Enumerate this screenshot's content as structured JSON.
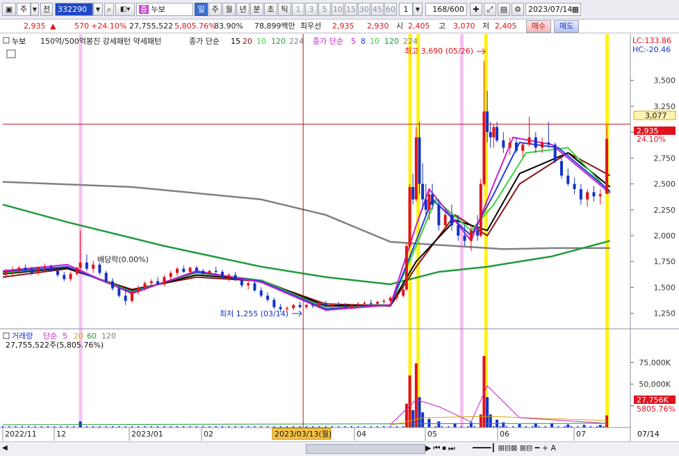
{
  "toolbar": {
    "market_select": "주",
    "prev_label": "전",
    "code": "332290",
    "group_icon": "중",
    "name": "누보",
    "periods": [
      "일",
      "주",
      "월",
      "년",
      "분",
      "초",
      "틱"
    ],
    "active_period": "일",
    "interval_buttons": [
      "1",
      "3",
      "5",
      "10",
      "15",
      "30",
      "45",
      "60"
    ],
    "interval_value": "1",
    "count": "168",
    "count_total": "/600",
    "date": "2023/07/14"
  },
  "quote": {
    "price": "2,935",
    "arrow": "▲",
    "change": "570",
    "change_pct": "+24.10%",
    "volume": "27,755,522",
    "volume_pct": "5,805.76%",
    "ratio": "83.90%",
    "amount": "78,899백만",
    "best_label": "최우선",
    "ask": "2,935",
    "bid": "2,930",
    "open_label": "시",
    "open": "2,405",
    "high_label": "고",
    "high": "3,070",
    "low_label": "저",
    "low": "2,405",
    "buy_button": "매수",
    "sell_button": "매도"
  },
  "legend": {
    "name": "누보",
    "pattern": "150억/500억봉진 강세패턴 약세패턴",
    "ma_price_label": "종가 단순",
    "ma_price_periods": [
      "15",
      "20",
      "10",
      "120",
      "224"
    ],
    "ma_price2_label": "종가 단순",
    "ma_price2_periods": [
      "5",
      "8",
      "10",
      "120",
      "224"
    ],
    "lc": "LC:133.86",
    "hc": "HC:-20.46"
  },
  "annotations": {
    "high": "최고 3,690 (05/26)",
    "low": "최저 1,255 (03/14)",
    "dividend": "배당락(0.00%)"
  },
  "price_labels": {
    "crosshair": "3,077",
    "current": "2,935",
    "current_pct": "24.10%"
  },
  "volume_panel": {
    "title": "거래량",
    "ma_label": "단순",
    "ma_periods": [
      "5",
      "20",
      "60",
      "120"
    ],
    "value": "27,755,522주(5,805.76%)",
    "current": "27,756K",
    "current_pct": "5805.76%"
  },
  "x_axis": {
    "ticks": [
      {
        "label": "2022/11",
        "x": 0
      },
      {
        "label": "12",
        "x": 22
      },
      {
        "label": "2023/01",
        "x": 44
      },
      {
        "label": "02",
        "x": 66
      },
      {
        "label": "04",
        "x": 110
      },
      {
        "label": "05",
        "x": 132
      },
      {
        "label": "06",
        "x": 154
      },
      {
        "label": "07",
        "x": 176
      }
    ],
    "cursor_date": "2023/03/13(월)",
    "right_date": "07/14"
  },
  "colors": {
    "up": "#e0131c",
    "down": "#1431c9",
    "ma5": "#c81fc8",
    "ma8": "#1f3fe0",
    "ma10": "#3ad33a",
    "ma15": "#000000",
    "ma20": "#8a1212",
    "ma120": "#1f9a3a",
    "ma224": "#808080",
    "highlight_yellow": "#fff100",
    "highlight_pink": "#f2b3ee"
  },
  "chart_data": {
    "type": "candlestick",
    "title": "누보",
    "x_range": [
      0,
      190
    ],
    "y_range": [
      1100,
      3800
    ],
    "y_ticks": [
      1250,
      1500,
      1750,
      2000,
      2250,
      2500,
      2750,
      3000,
      3250,
      3500
    ],
    "y_tick_labels": [
      "1,250",
      "1,500",
      "1,750",
      "2,000",
      "2,250",
      "2,500",
      "2,750",
      "3,000",
      "3,250",
      "3,500"
    ],
    "volume_ticks": [
      25000,
      50000,
      75000
    ],
    "volume_tick_labels": [
      "",
      "50,000K",
      "75,000K"
    ],
    "crosshair_x": 93,
    "crosshair_price": 3077,
    "current_price": 2935,
    "highlight_days": [
      {
        "x": 24,
        "color": "pink"
      },
      {
        "x": 126,
        "color": "yellow"
      },
      {
        "x": 128.5,
        "color": "yellow"
      },
      {
        "x": 142,
        "color": "pink"
      },
      {
        "x": 149.5,
        "color": "yellow"
      },
      {
        "x": 187,
        "color": "yellow"
      }
    ],
    "moving_averages": [
      {
        "name": "224",
        "color_key": "ma224",
        "points": [
          [
            0,
            2520
          ],
          [
            40,
            2470
          ],
          [
            80,
            2350
          ],
          [
            100,
            2200
          ],
          [
            120,
            1940
          ],
          [
            140,
            1900
          ],
          [
            155,
            1870
          ],
          [
            170,
            1880
          ],
          [
            188,
            1880
          ]
        ]
      },
      {
        "name": "120",
        "color_key": "ma120",
        "points": [
          [
            0,
            2300
          ],
          [
            20,
            2130
          ],
          [
            50,
            1900
          ],
          [
            80,
            1700
          ],
          [
            100,
            1600
          ],
          [
            120,
            1530
          ],
          [
            135,
            1650
          ],
          [
            150,
            1700
          ],
          [
            170,
            1800
          ],
          [
            188,
            1950
          ]
        ]
      },
      {
        "name": "20",
        "color_key": "ma20",
        "points": [
          [
            0,
            1600
          ],
          [
            20,
            1680
          ],
          [
            40,
            1480
          ],
          [
            60,
            1600
          ],
          [
            80,
            1560
          ],
          [
            100,
            1340
          ],
          [
            120,
            1320
          ],
          [
            128,
            1700
          ],
          [
            140,
            2200
          ],
          [
            150,
            2000
          ],
          [
            160,
            2500
          ],
          [
            175,
            2800
          ],
          [
            188,
            2580
          ]
        ]
      },
      {
        "name": "15",
        "color_key": "ma15",
        "points": [
          [
            0,
            1630
          ],
          [
            20,
            1690
          ],
          [
            40,
            1470
          ],
          [
            60,
            1620
          ],
          [
            80,
            1570
          ],
          [
            100,
            1320
          ],
          [
            120,
            1330
          ],
          [
            128,
            1750
          ],
          [
            140,
            2150
          ],
          [
            150,
            2050
          ],
          [
            160,
            2600
          ],
          [
            175,
            2800
          ],
          [
            188,
            2470
          ]
        ]
      },
      {
        "name": "10",
        "color_key": "ma10",
        "points": [
          [
            0,
            1640
          ],
          [
            20,
            1700
          ],
          [
            40,
            1460
          ],
          [
            60,
            1640
          ],
          [
            80,
            1570
          ],
          [
            100,
            1300
          ],
          [
            120,
            1330
          ],
          [
            128,
            1900
          ],
          [
            134,
            2350
          ],
          [
            145,
            2050
          ],
          [
            152,
            2300
          ],
          [
            162,
            2800
          ],
          [
            175,
            2850
          ],
          [
            188,
            2420
          ]
        ]
      },
      {
        "name": "8",
        "color_key": "ma8",
        "points": [
          [
            0,
            1650
          ],
          [
            20,
            1700
          ],
          [
            40,
            1450
          ],
          [
            60,
            1650
          ],
          [
            80,
            1560
          ],
          [
            100,
            1290
          ],
          [
            120,
            1330
          ],
          [
            128,
            1950
          ],
          [
            133,
            2350
          ],
          [
            145,
            2000
          ],
          [
            152,
            2400
          ],
          [
            160,
            2900
          ],
          [
            172,
            2850
          ],
          [
            188,
            2430
          ]
        ]
      },
      {
        "name": "5",
        "color_key": "ma5",
        "points": [
          [
            0,
            1660
          ],
          [
            20,
            1720
          ],
          [
            40,
            1440
          ],
          [
            60,
            1660
          ],
          [
            80,
            1550
          ],
          [
            100,
            1280
          ],
          [
            120,
            1330
          ],
          [
            128,
            2100
          ],
          [
            132,
            2450
          ],
          [
            145,
            1950
          ],
          [
            152,
            2500
          ],
          [
            158,
            2950
          ],
          [
            170,
            2880
          ],
          [
            188,
            2410
          ]
        ]
      }
    ],
    "candles": [
      [
        1,
        1620,
        1680,
        1590,
        1650
      ],
      [
        3,
        1650,
        1700,
        1610,
        1660
      ],
      [
        5,
        1660,
        1710,
        1630,
        1690
      ],
      [
        7,
        1690,
        1720,
        1640,
        1670
      ],
      [
        9,
        1670,
        1700,
        1620,
        1640
      ],
      [
        11,
        1640,
        1700,
        1620,
        1690
      ],
      [
        13,
        1690,
        1730,
        1660,
        1700
      ],
      [
        15,
        1700,
        1720,
        1650,
        1660
      ],
      [
        17,
        1660,
        1690,
        1600,
        1620
      ],
      [
        19,
        1620,
        1650,
        1560,
        1580
      ],
      [
        21,
        1580,
        1650,
        1560,
        1630
      ],
      [
        23,
        1630,
        1700,
        1610,
        1690
      ],
      [
        24,
        1690,
        2050,
        1670,
        1740
      ],
      [
        26,
        1740,
        1820,
        1660,
        1680
      ],
      [
        28,
        1680,
        1760,
        1640,
        1720
      ],
      [
        30,
        1720,
        1740,
        1620,
        1640
      ],
      [
        32,
        1640,
        1660,
        1540,
        1560
      ],
      [
        34,
        1560,
        1590,
        1470,
        1490
      ],
      [
        36,
        1490,
        1520,
        1400,
        1420
      ],
      [
        38,
        1420,
        1480,
        1330,
        1370
      ],
      [
        40,
        1370,
        1470,
        1350,
        1460
      ],
      [
        42,
        1460,
        1520,
        1430,
        1500
      ],
      [
        44,
        1500,
        1560,
        1470,
        1540
      ],
      [
        46,
        1540,
        1580,
        1500,
        1560
      ],
      [
        48,
        1560,
        1600,
        1520,
        1530
      ],
      [
        50,
        1530,
        1620,
        1510,
        1600
      ],
      [
        52,
        1600,
        1660,
        1570,
        1640
      ],
      [
        54,
        1640,
        1700,
        1610,
        1680
      ],
      [
        56,
        1680,
        1710,
        1640,
        1650
      ],
      [
        58,
        1650,
        1700,
        1620,
        1690
      ],
      [
        60,
        1690,
        1710,
        1640,
        1660
      ],
      [
        62,
        1660,
        1680,
        1610,
        1630
      ],
      [
        64,
        1630,
        1670,
        1600,
        1660
      ],
      [
        66,
        1660,
        1700,
        1630,
        1650
      ],
      [
        68,
        1650,
        1670,
        1580,
        1600
      ],
      [
        70,
        1600,
        1640,
        1560,
        1620
      ],
      [
        72,
        1620,
        1650,
        1560,
        1570
      ],
      [
        74,
        1570,
        1590,
        1500,
        1520
      ],
      [
        76,
        1520,
        1560,
        1480,
        1540
      ],
      [
        78,
        1540,
        1560,
        1460,
        1470
      ],
      [
        80,
        1470,
        1500,
        1400,
        1420
      ],
      [
        82,
        1420,
        1450,
        1360,
        1380
      ],
      [
        84,
        1380,
        1400,
        1290,
        1310
      ],
      [
        86,
        1310,
        1340,
        1260,
        1290
      ],
      [
        88,
        1290,
        1320,
        1255,
        1300
      ],
      [
        90,
        1300,
        1340,
        1280,
        1330
      ],
      [
        92,
        1330,
        1360,
        1300,
        1310
      ],
      [
        94,
        1310,
        1340,
        1290,
        1330
      ],
      [
        96,
        1330,
        1350,
        1300,
        1320
      ],
      [
        98,
        1320,
        1370,
        1300,
        1350
      ],
      [
        100,
        1350,
        1370,
        1310,
        1320
      ],
      [
        102,
        1320,
        1350,
        1300,
        1340
      ],
      [
        104,
        1340,
        1360,
        1310,
        1330
      ],
      [
        106,
        1330,
        1350,
        1300,
        1310
      ],
      [
        108,
        1310,
        1340,
        1290,
        1330
      ],
      [
        110,
        1330,
        1360,
        1310,
        1340
      ],
      [
        112,
        1340,
        1370,
        1320,
        1350
      ],
      [
        114,
        1350,
        1380,
        1330,
        1340
      ],
      [
        116,
        1340,
        1370,
        1320,
        1360
      ],
      [
        118,
        1360,
        1390,
        1340,
        1370
      ],
      [
        120,
        1370,
        1420,
        1350,
        1400
      ],
      [
        122,
        1400,
        1450,
        1370,
        1420
      ],
      [
        124,
        1420,
        1500,
        1400,
        1480
      ],
      [
        125,
        1480,
        1930,
        1470,
        1900
      ],
      [
        126,
        1900,
        2500,
        1880,
        2470
      ],
      [
        127,
        2470,
        2600,
        2300,
        2350
      ],
      [
        128,
        2350,
        3050,
        2330,
        2950
      ],
      [
        129,
        2950,
        3100,
        2400,
        2500
      ],
      [
        130,
        2500,
        2700,
        2250,
        2350
      ],
      [
        131,
        2350,
        2500,
        2200,
        2250
      ],
      [
        132,
        2250,
        2450,
        2150,
        2400
      ],
      [
        133,
        2400,
        2500,
        2250,
        2300
      ],
      [
        135,
        2300,
        2350,
        2050,
        2100
      ],
      [
        137,
        2100,
        2250,
        2050,
        2200
      ],
      [
        139,
        2200,
        2300,
        2050,
        2100
      ],
      [
        141,
        2100,
        2200,
        1950,
        2000
      ],
      [
        143,
        2000,
        2100,
        1900,
        1950
      ],
      [
        145,
        1950,
        2100,
        1850,
        2050
      ],
      [
        147,
        2050,
        2200,
        1950,
        2000
      ],
      [
        148,
        2000,
        2550,
        1980,
        2500
      ],
      [
        149,
        2500,
        3690,
        2480,
        3200
      ],
      [
        150,
        3200,
        3400,
        2900,
        3000
      ],
      [
        151,
        3000,
        3100,
        2850,
        2950
      ],
      [
        152,
        2950,
        3080,
        2850,
        3050
      ],
      [
        153,
        3050,
        3100,
        2900,
        2920
      ],
      [
        155,
        2920,
        3000,
        2800,
        2850
      ],
      [
        157,
        2850,
        2950,
        2780,
        2900
      ],
      [
        159,
        2900,
        2950,
        2800,
        2820
      ],
      [
        161,
        2820,
        2900,
        2760,
        2880
      ],
      [
        163,
        2880,
        3150,
        2860,
        2950
      ],
      [
        165,
        2950,
        3000,
        2800,
        2850
      ],
      [
        167,
        2850,
        2950,
        2800,
        2900
      ],
      [
        169,
        2900,
        3100,
        2850,
        2880
      ],
      [
        171,
        2880,
        2900,
        2700,
        2720
      ],
      [
        173,
        2720,
        2780,
        2550,
        2580
      ],
      [
        175,
        2580,
        2650,
        2480,
        2500
      ],
      [
        177,
        2500,
        2560,
        2400,
        2450
      ],
      [
        179,
        2450,
        2500,
        2300,
        2350
      ],
      [
        181,
        2350,
        2450,
        2280,
        2420
      ],
      [
        183,
        2420,
        2480,
        2330,
        2380
      ],
      [
        185,
        2380,
        2450,
        2300,
        2400
      ],
      [
        187,
        2405,
        3070,
        2405,
        2935
      ]
    ],
    "volumes": [
      [
        24,
        14
      ],
      [
        125,
        55
      ],
      [
        126,
        120
      ],
      [
        127,
        40
      ],
      [
        128,
        148
      ],
      [
        129,
        70
      ],
      [
        130,
        35
      ],
      [
        132,
        20
      ],
      [
        135,
        14
      ],
      [
        140,
        10
      ],
      [
        145,
        12
      ],
      [
        148,
        30
      ],
      [
        149,
        165
      ],
      [
        150,
        70
      ],
      [
        151,
        30
      ],
      [
        153,
        18
      ],
      [
        155,
        12
      ],
      [
        160,
        8
      ],
      [
        165,
        10
      ],
      [
        170,
        9
      ],
      [
        175,
        7
      ],
      [
        180,
        6
      ],
      [
        185,
        6
      ],
      [
        187,
        28
      ]
    ]
  }
}
